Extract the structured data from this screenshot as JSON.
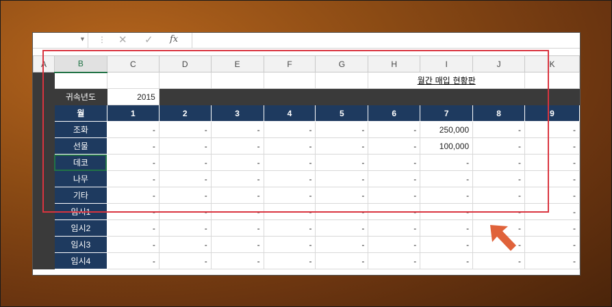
{
  "formula_bar": {
    "fx_label": "fx",
    "cancel_icon": "close-icon",
    "enter_icon": "check-icon"
  },
  "columns": [
    "A",
    "B",
    "C",
    "D",
    "E",
    "F",
    "G",
    "H",
    "I",
    "J",
    "K"
  ],
  "selected_column": "B",
  "title": "월간 매입 현황판",
  "year_label": "귀속년도",
  "year_value": "2015",
  "month_header_label": "월",
  "months": [
    "1",
    "2",
    "3",
    "4",
    "5",
    "6",
    "7",
    "8",
    "9"
  ],
  "rows": [
    {
      "label": "조화",
      "values": [
        "-",
        "-",
        "-",
        "-",
        "-",
        "-",
        "250,000",
        "-",
        "-"
      ]
    },
    {
      "label": "선물",
      "values": [
        "-",
        "-",
        "-",
        "-",
        "-",
        "-",
        "100,000",
        "-",
        "-"
      ]
    },
    {
      "label": "데코",
      "values": [
        "-",
        "-",
        "-",
        "-",
        "-",
        "-",
        "-",
        "-",
        "-"
      ]
    },
    {
      "label": "나무",
      "values": [
        "-",
        "-",
        "-",
        "-",
        "-",
        "-",
        "-",
        "-",
        "-"
      ]
    },
    {
      "label": "기타",
      "values": [
        "-",
        "-",
        "-",
        "-",
        "-",
        "-",
        "-",
        "-",
        "-"
      ]
    },
    {
      "label": "임시1",
      "values": [
        "-",
        "-",
        "-",
        "-",
        "-",
        "-",
        "-",
        "-",
        "-"
      ]
    },
    {
      "label": "임시2",
      "values": [
        "-",
        "-",
        "-",
        "-",
        "-",
        "-",
        "-",
        "-",
        "-"
      ]
    },
    {
      "label": "임시3",
      "values": [
        "-",
        "-",
        "-",
        "-",
        "-",
        "-",
        "-",
        "-",
        "-"
      ]
    },
    {
      "label": "임시4",
      "values": [
        "-",
        "-",
        "-",
        "-",
        "-",
        "-",
        "-",
        "-",
        "-"
      ]
    }
  ],
  "colors": {
    "header_fill": "#1e3a5f",
    "highlight_box": "#d9343f",
    "arrow": "#e0623a",
    "selection": "#217346"
  }
}
